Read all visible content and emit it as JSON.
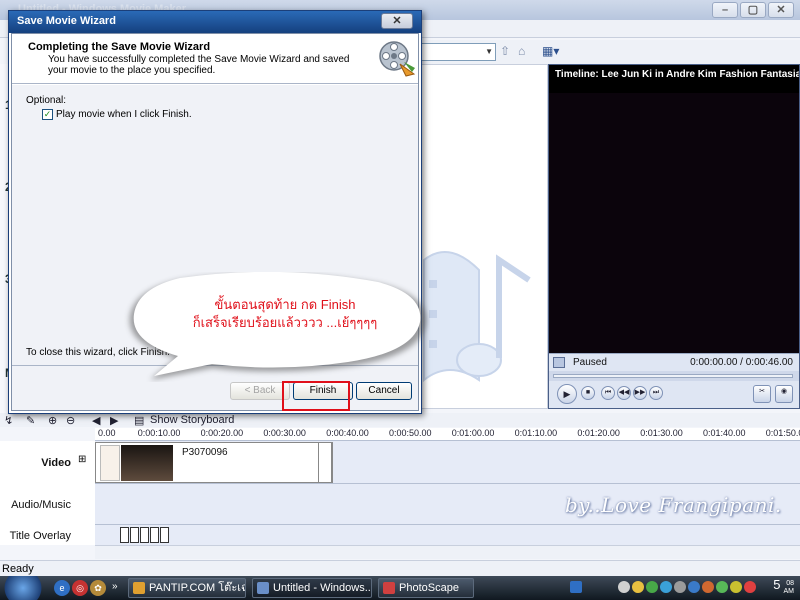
{
  "app": {
    "title": "Untitled - Windows Movie Maker",
    "min": "–",
    "max": "▢",
    "close": "✕"
  },
  "task_pane": {
    "steps": [
      "1",
      "2",
      "3",
      "M"
    ]
  },
  "monitor": {
    "title": "Timeline: Lee Jun Ki in Andre Kim Fashion Fantasia...",
    "status": "Paused",
    "time": "0:00:00.00 / 0:00:46.00"
  },
  "timeline": {
    "show_storyboard": "Show Storyboard",
    "ticks": [
      "0.00",
      "0:00:10.00",
      "0:00:20.00",
      "0:00:30.00",
      "0:00:40.00",
      "0:00:50.00",
      "0:01:00.00",
      "0:01:10.00",
      "0:01:20.00",
      "0:01:30.00",
      "0:01:40.00",
      "0:01:50.00"
    ],
    "tracks": {
      "video": "Video",
      "audio": "Audio/Music",
      "title": "Title Overlay"
    },
    "clip_name": "P3070096",
    "signature": "by..Love Frangipani."
  },
  "status_bar": {
    "text": "Ready"
  },
  "dialog": {
    "title": "Save Movie Wizard",
    "close": "✕",
    "heading": "Completing the Save Movie Wizard",
    "subheading": "You have successfully completed the Save Movie Wizard and saved your movie to the place you specified.",
    "optional_label": "Optional:",
    "checkbox_label": "Play movie when I click Finish.",
    "checkbox_checked": true,
    "close_hint": "To close this wizard, click Finish.",
    "back_label": "< Back",
    "finish_label": "Finish",
    "cancel_label": "Cancel"
  },
  "callout": {
    "line1": "ขั้นตอนสุดท้าย กด Finish",
    "line2": "ก็เสร็จเรียบร้อยแล้วววว ...เย้ๆๆๆๆ"
  },
  "taskbar": {
    "tasks": [
      {
        "label": "PANTIP.COM โต๊ะเฉ...",
        "icon_color": "#e0a030"
      },
      {
        "label": "Untitled - Windows...",
        "icon_color": "#6a8fc8"
      },
      {
        "label": "PhotoScape",
        "icon_color": "#d04040"
      }
    ],
    "clock_hour": "5",
    "clock_min": "08",
    "clock_ampm": "AM"
  },
  "colors": {
    "accent": "#e0101a",
    "dialog_title": "#1f56a0",
    "taskbar": "#1e2733"
  }
}
